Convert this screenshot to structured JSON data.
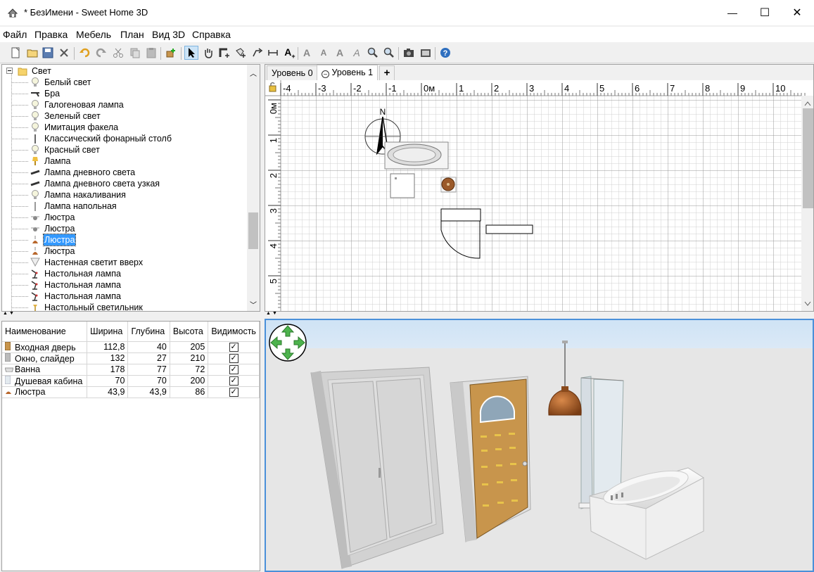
{
  "window": {
    "title": "* БезИмени - Sweet Home 3D",
    "minimize_glyph": "—",
    "maximize_glyph": "☐",
    "close_glyph": "✕"
  },
  "menu": [
    "Файл",
    "Правка",
    "Мебель",
    "План",
    "Вид 3D",
    "Справка"
  ],
  "toolbar_icons": [
    "new-home-icon",
    "open-icon",
    "save-icon",
    "preferences-icon",
    "undo-icon",
    "redo-icon",
    "cut-icon",
    "copy-icon",
    "paste-icon",
    "add-furniture-icon",
    "select-mode-icon",
    "pan-mode-icon",
    "create-walls-icon",
    "create-rooms-icon",
    "create-polylines-icon",
    "create-dimensions-icon",
    "add-text-icon",
    "increase-text-icon",
    "decrease-text-icon",
    "bold-text-icon",
    "italic-text-icon",
    "zoom-in-icon",
    "zoom-out-icon",
    "create-photo-icon",
    "create-video-icon",
    "help-icon"
  ],
  "catalog": {
    "category": "Свет",
    "items": [
      {
        "label": "Белый свет",
        "icon": "bulb-icon"
      },
      {
        "label": "Бра",
        "icon": "wall-lamp-icon"
      },
      {
        "label": "Галогеновая лампа",
        "icon": "bulb-icon"
      },
      {
        "label": "Зеленый свет",
        "icon": "bulb-icon"
      },
      {
        "label": "Имитация факела",
        "icon": "bulb-icon"
      },
      {
        "label": "Классический фонарный столб",
        "icon": "streetlight-icon"
      },
      {
        "label": "Красный свет",
        "icon": "bulb-icon"
      },
      {
        "label": "Лампа",
        "icon": "lamp-icon"
      },
      {
        "label": "Лампа дневного света",
        "icon": "tube-lamp-icon"
      },
      {
        "label": "Лампа дневного света узкая",
        "icon": "tube-lamp-icon"
      },
      {
        "label": "Лампа накаливания",
        "icon": "bulb-icon"
      },
      {
        "label": "Лампа напольная",
        "icon": "floor-lamp-icon"
      },
      {
        "label": "Люстра",
        "icon": "chandelier-icon"
      },
      {
        "label": "Люстра",
        "icon": "chandelier-icon"
      },
      {
        "label": "Люстра",
        "icon": "pendant-icon",
        "selected": true
      },
      {
        "label": "Люстра",
        "icon": "pendant-icon"
      },
      {
        "label": "Настенная светит вверх",
        "icon": "uplight-icon"
      },
      {
        "label": "Настольная лампа",
        "icon": "desk-lamp-icon"
      },
      {
        "label": "Настольная лампа",
        "icon": "desk-lamp-icon"
      },
      {
        "label": "Настольная лампа",
        "icon": "desk-lamp-icon"
      },
      {
        "label": "Настольный светильник",
        "icon": "table-light-icon"
      }
    ]
  },
  "furniture_table": {
    "columns": [
      "Наименование",
      "Ширина",
      "Глубина",
      "Высота",
      "Видимость"
    ],
    "rows": [
      {
        "name": "Входная дверь",
        "width": "112,8",
        "depth": "40",
        "height": "205",
        "visible": "✓",
        "icon": "door-icon"
      },
      {
        "name": "Окно, слайдер",
        "width": "132",
        "depth": "27",
        "height": "210",
        "visible": "✓",
        "icon": "window-icon"
      },
      {
        "name": "Ванна",
        "width": "178",
        "depth": "77",
        "height": "72",
        "visible": "✓",
        "icon": "bathtub-icon"
      },
      {
        "name": "Душевая кабина",
        "width": "70",
        "depth": "70",
        "height": "200",
        "visible": "✓",
        "icon": "shower-icon"
      },
      {
        "name": "Люстра",
        "width": "43,9",
        "depth": "43,9",
        "height": "86",
        "visible": "✓",
        "icon": "pendant-icon"
      }
    ]
  },
  "plan": {
    "tabs": [
      {
        "label": "Уровень 0",
        "active": false
      },
      {
        "label": "Уровень 1",
        "active": true
      }
    ],
    "add_tab_glyph": "+",
    "ruler_x": [
      "-4",
      "-3",
      "-2",
      "-1",
      "0м",
      "1",
      "2",
      "3",
      "4",
      "5",
      "6",
      "7",
      "8",
      "9",
      "10"
    ],
    "ruler_y": [
      "0м",
      "1",
      "2",
      "3",
      "4",
      "5"
    ],
    "compass_label": "N"
  },
  "colors": {
    "selection": "#3399ff",
    "view3d_border": "#4a90d9",
    "door_wood": "#c8954c",
    "lamp_copper": "#b8672c"
  }
}
